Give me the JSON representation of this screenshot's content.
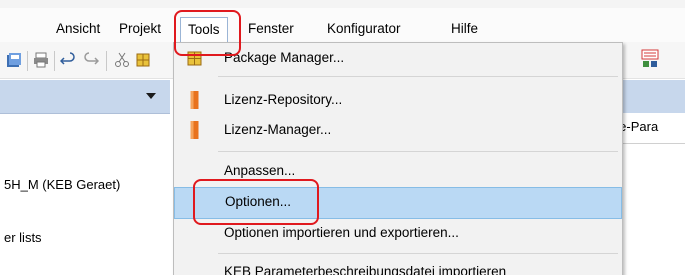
{
  "menubar": {
    "items": [
      {
        "label": "Ansicht"
      },
      {
        "label": "Projekt"
      },
      {
        "label": "Tools",
        "active": true
      },
      {
        "label": "Fenster"
      },
      {
        "label": "Konfigurator"
      },
      {
        "label": "Hilfe"
      }
    ]
  },
  "left_panel": {
    "tree_item": "5H_M (KEB Geraet)",
    "list_item": "er lists"
  },
  "right_panel": {
    "tab_label": "räte-Para"
  },
  "tools_menu": {
    "items": [
      {
        "label": "Package Manager...",
        "icon": "package-manager-icon"
      },
      {
        "label": "Lizenz-Repository...",
        "icon": "license-icon"
      },
      {
        "label": "Lizenz-Manager...",
        "icon": "license-icon"
      },
      {
        "label": "Anpassen...",
        "icon": ""
      },
      {
        "label": "Optionen...",
        "icon": "",
        "hover": true
      },
      {
        "label": "Optionen importieren und exportieren...",
        "icon": ""
      },
      {
        "label": "KEB Parameterbeschreibungsdatei importieren",
        "icon": ""
      }
    ]
  },
  "colors": {
    "highlight": "#e0191e",
    "hover": "#bad9f4",
    "panel_header": "#c7d7ec"
  }
}
